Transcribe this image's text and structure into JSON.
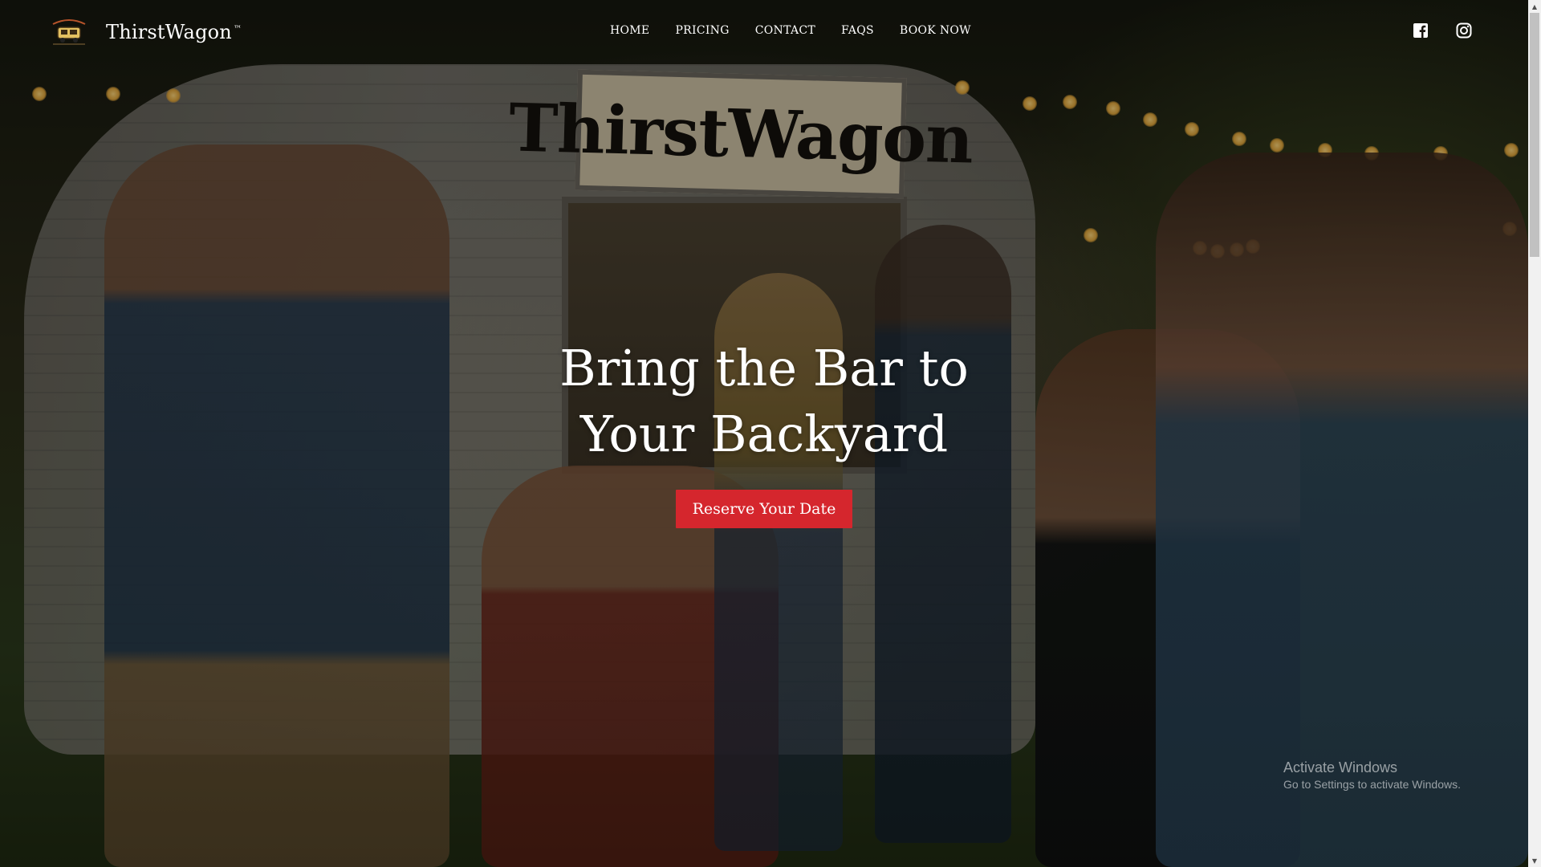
{
  "brand": {
    "name": "ThirstWagon",
    "trademark": "™",
    "logo_icon": "food-truck-logo"
  },
  "nav": {
    "items": [
      {
        "label": "HOME"
      },
      {
        "label": "PRICING"
      },
      {
        "label": "CONTACT"
      },
      {
        "label": "FAQS"
      },
      {
        "label": "BOOK NOW"
      }
    ]
  },
  "social": {
    "facebook_icon": "facebook-icon",
    "instagram_icon": "instagram-icon"
  },
  "hero": {
    "sign_text": "ThirstWagon",
    "title_line1": "Bring the Bar to",
    "title_line2": "Your Backyard",
    "cta_label": "Reserve Your Date",
    "image_description_icon": "hero-photo"
  },
  "watermark": {
    "title": "Activate Windows",
    "subtitle": "Go to Settings to activate Windows."
  },
  "colors": {
    "accent": "#d5262d",
    "text": "#ffffff"
  }
}
